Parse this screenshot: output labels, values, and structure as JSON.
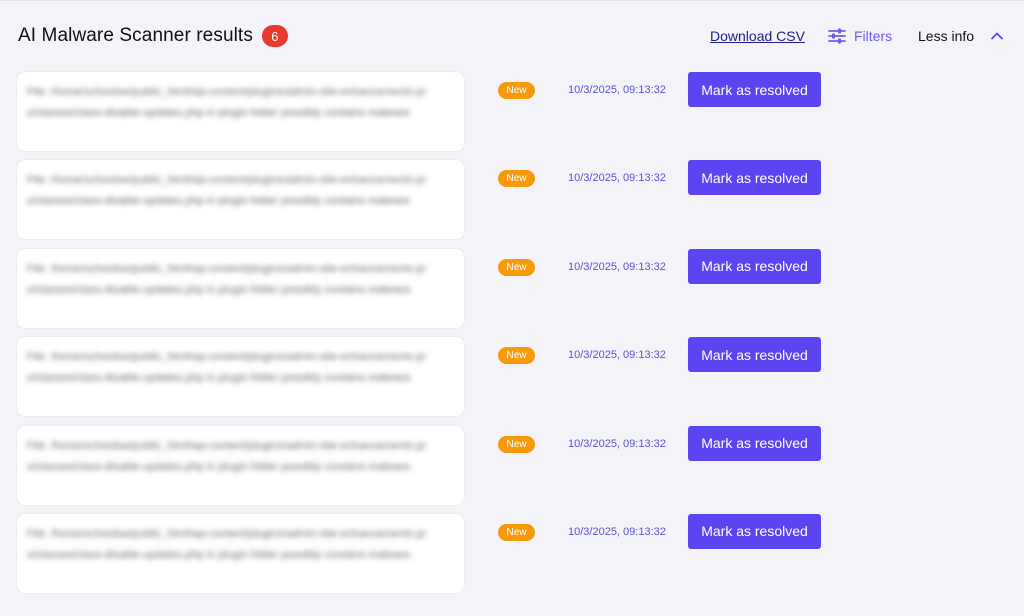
{
  "header": {
    "title": "AI Malware Scanner results",
    "count": "6",
    "download_label": "Download CSV",
    "filters_label": "Filters",
    "less_info_label": "Less info"
  },
  "colors": {
    "accent": "#5b45f2",
    "count_badge": "#e8392f",
    "status_new": "#f7990c",
    "timestamp": "#5a52d6"
  },
  "icons": {
    "filters": "sliders-icon",
    "collapse": "chevron-up-icon"
  },
  "results": [
    {
      "description": "File: /home/schoolsw/public_html/wp-content/plugins/admin-site-enhancements-pro/classes/class-disable-updates.php in plugin folder possibly contains malware.",
      "status": "New",
      "timestamp": "10/3/2025, 09:13:32",
      "action": "Mark as resolved"
    },
    {
      "description": "File: /home/schoolsw/public_html/wp-content/plugins/admin-site-enhancements-pro/classes/class-disable-updates.php in plugin folder possibly contains malware.",
      "status": "New",
      "timestamp": "10/3/2025, 09:13:32",
      "action": "Mark as resolved"
    },
    {
      "description": "File: /home/schoolsw/public_html/wp-content/plugins/admin-site-enhancements-pro/classes/class-disable-updates.php in plugin folder possibly contains malware.",
      "status": "New",
      "timestamp": "10/3/2025, 09:13:32",
      "action": "Mark as resolved"
    },
    {
      "description": "File: /home/schoolsw/public_html/wp-content/plugins/admin-site-enhancements-pro/classes/class-disable-updates.php in plugin folder possibly contains malware.",
      "status": "New",
      "timestamp": "10/3/2025, 09:13:32",
      "action": "Mark as resolved"
    },
    {
      "description": "File: /home/schoolsw/public_html/wp-content/plugins/admin-site-enhancements-pro/classes/class-disable-updates.php in plugin folder possibly contains malware.",
      "status": "New",
      "timestamp": "10/3/2025, 09:13:32",
      "action": "Mark as resolved"
    },
    {
      "description": "File: /home/schoolsw/public_html/wp-content/plugins/admin-site-enhancements-pro/classes/class-disable-updates.php in plugin folder possibly contains malware.",
      "status": "New",
      "timestamp": "10/3/2025, 09:13:32",
      "action": "Mark as resolved"
    }
  ]
}
